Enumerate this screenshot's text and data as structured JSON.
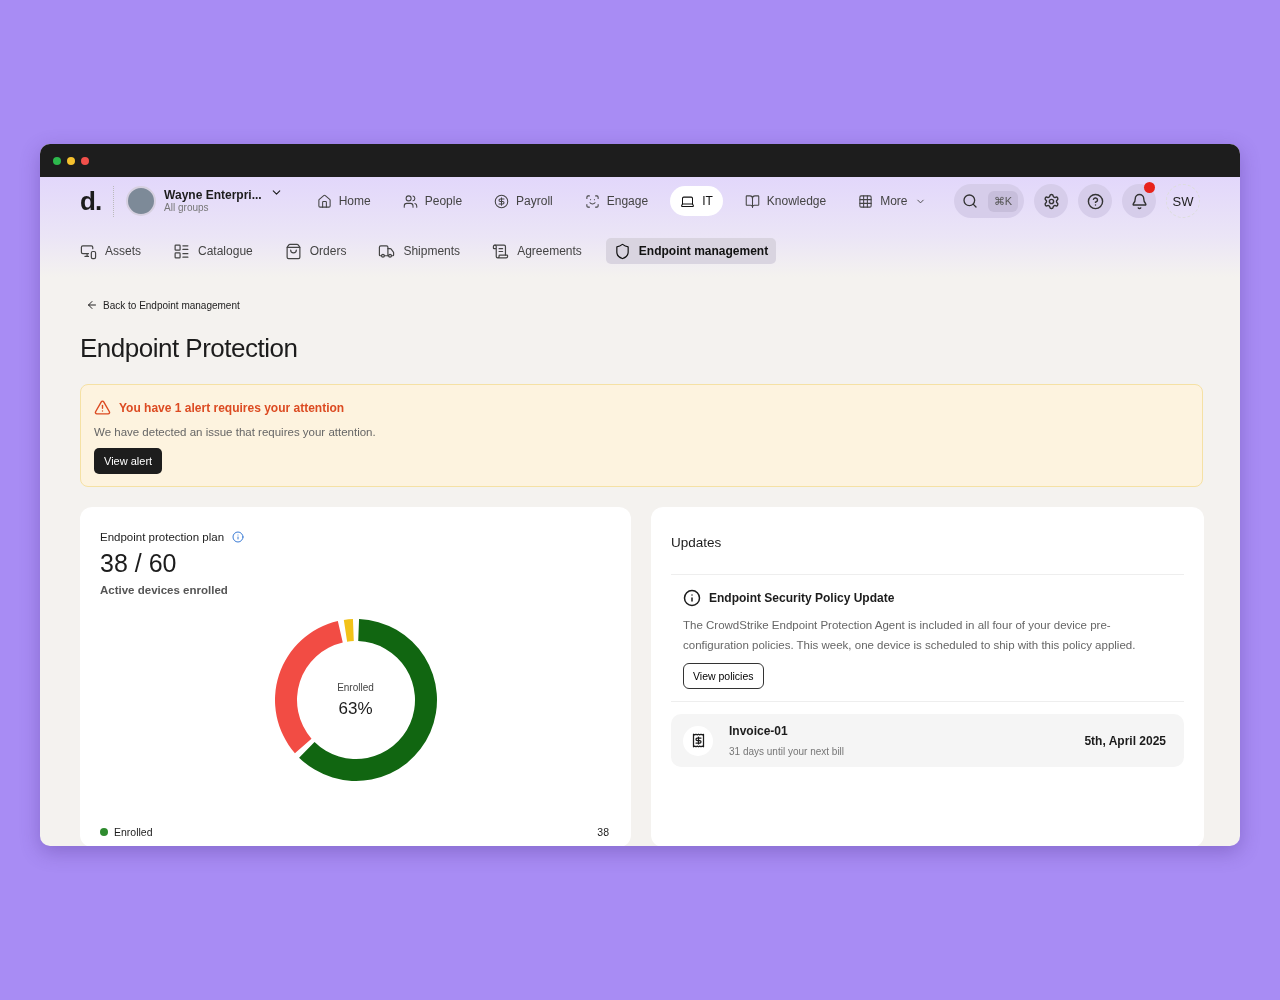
{
  "window": {
    "controls": [
      {
        "color": "#2db84d"
      },
      {
        "color": "#f5c12e"
      },
      {
        "color": "#f2504b"
      }
    ]
  },
  "top_nav": {
    "logo": "d.",
    "org": {
      "name": "Wayne Enterpri...",
      "sub": "All groups"
    },
    "items": [
      {
        "label": "Home",
        "selected": false
      },
      {
        "label": "People",
        "selected": false
      },
      {
        "label": "Payroll",
        "selected": false
      },
      {
        "label": "Engage",
        "selected": false
      },
      {
        "label": "IT",
        "selected": true
      },
      {
        "label": "Knowledge",
        "selected": false
      },
      {
        "label": "More",
        "selected": false
      }
    ],
    "search_shortcut": "⌘K",
    "notifications": true,
    "avatar": "SW"
  },
  "sub_nav": [
    {
      "label": "Assets",
      "selected": false
    },
    {
      "label": "Catalogue",
      "selected": false
    },
    {
      "label": "Orders",
      "selected": false
    },
    {
      "label": "Shipments",
      "selected": false
    },
    {
      "label": "Agreements",
      "selected": false
    },
    {
      "label": "Endpoint management",
      "selected": true
    }
  ],
  "back_link": "Back to Endpoint management",
  "title": "Endpoint Protection",
  "alert": {
    "title": "You have 1 alert requires your attention",
    "text": "We have detected an issue that requires your attention.",
    "button": "View alert"
  },
  "plan": {
    "title": "Endpoint protection plan",
    "count": "38 / 60",
    "caption": "Active devices enrolled",
    "donut": {
      "label": "Enrolled",
      "value": "63%",
      "chart_data": {
        "type": "donut",
        "values": [
          63,
          34,
          3
        ]
      }
    },
    "legend": [
      {
        "label": "Enrolled",
        "value": "38",
        "color": "#2e8b2e"
      }
    ]
  },
  "updates": {
    "title": "Updates",
    "notice": {
      "title": "Endpoint Security Policy Update",
      "text": "The CrowdStrike Endpoint Protection Agent is included in all four of your device pre-configuration policies. This week, one device is scheduled to ship with this policy applied.",
      "button": "View policies"
    },
    "invoice": {
      "name": "Invoice-01",
      "sub": "31 days until your next bill",
      "date": "5th, April 2025"
    }
  }
}
